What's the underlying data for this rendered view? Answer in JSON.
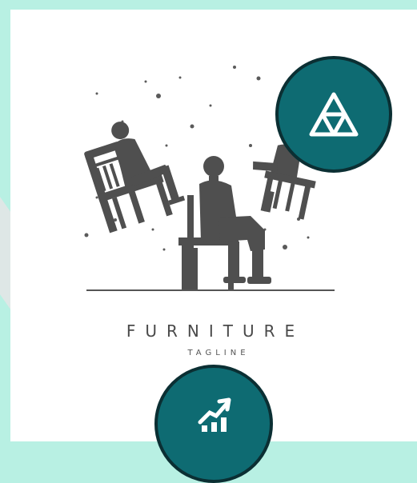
{
  "logo": {
    "brand": "FURNITURE",
    "tagline": "TAGLINE"
  },
  "badges": [
    {
      "icon": "triangle-icon"
    },
    {
      "icon": "growth-chart-icon"
    }
  ],
  "colors": {
    "background": "#b8f0e3",
    "card": "#ffffff",
    "badge_fill": "#0e6b72",
    "badge_border": "#0b2f33",
    "silhouette": "#4f4f4f"
  }
}
